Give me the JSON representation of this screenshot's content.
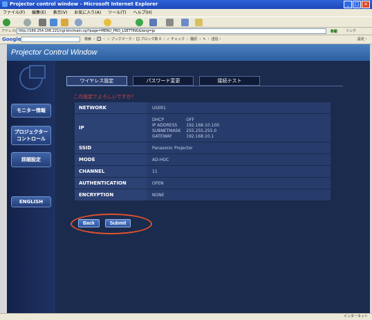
{
  "browser": {
    "title": "Projector control window - Microsoft Internet Explorer",
    "menu": [
      "ファイル(F)",
      "編集(E)",
      "表示(V)",
      "お気に入り(A)",
      "ツール(T)",
      "ヘルプ(H)"
    ],
    "address_label": "アドレス(D)",
    "address_url": "http://169.254.106.221/cgi-bin/main.cgi?page=MENU_PRO_LSETTING&lang=jp",
    "go_label": "移動",
    "links_label": "リンク",
    "google_label": "Google",
    "google_items": "検索 ・ 🔲 ・ ☆ ブックマーク・ 🖸 ブロック数 0 ・ ✓ チェック ・ 翻訳 ・ ✎ ・ 送信・",
    "google_settings": "設定・",
    "status_zone": "インターネット",
    "colors": {
      "titlebar": "#2f62d8",
      "chrome": "#ece9d8"
    }
  },
  "app": {
    "header": "Projector Control Window",
    "sidebar": {
      "monitor": "モニター情報",
      "projector_control": "プロジェクター\nコントロール",
      "detail_settings": "詳細設定",
      "english": "ENGLISH"
    },
    "tabs": [
      "ワイヤレス設定",
      "パスワード変更",
      "接続テスト"
    ],
    "confirm_text": "この設定でよろしいですか？",
    "rows": {
      "network": {
        "label": "NETWORK",
        "value": "USER1"
      },
      "ip": {
        "label": "IP",
        "dhcp_k": "DHCP",
        "dhcp_v": "OFF",
        "ipaddr_k": "IP ADDRESS",
        "ipaddr_v": "192.168.10.100",
        "mask_k": "SUBNETMASK",
        "mask_v": "255.255.255.0",
        "gw_k": "GATEWAY",
        "gw_v": "192.168.10.1"
      },
      "ssid": {
        "label": "SSID",
        "value": "Panasonic Projector"
      },
      "mode": {
        "label": "MODE",
        "value": "AD-HOC"
      },
      "channel": {
        "label": "CHANNEL",
        "value": "11"
      },
      "authentication": {
        "label": "AUTHENTICATION",
        "value": "OPEN"
      },
      "encryption": {
        "label": "ENCRYPTION",
        "value": "NONE"
      }
    },
    "buttons": {
      "back": "Back",
      "submit": "Submit"
    },
    "colors": {
      "panel": "#1b2b4e",
      "label_cell": "#2d4274",
      "value_cell": "#283c6b",
      "warn": "#d04a4a",
      "highlight": "#e0522c"
    }
  }
}
